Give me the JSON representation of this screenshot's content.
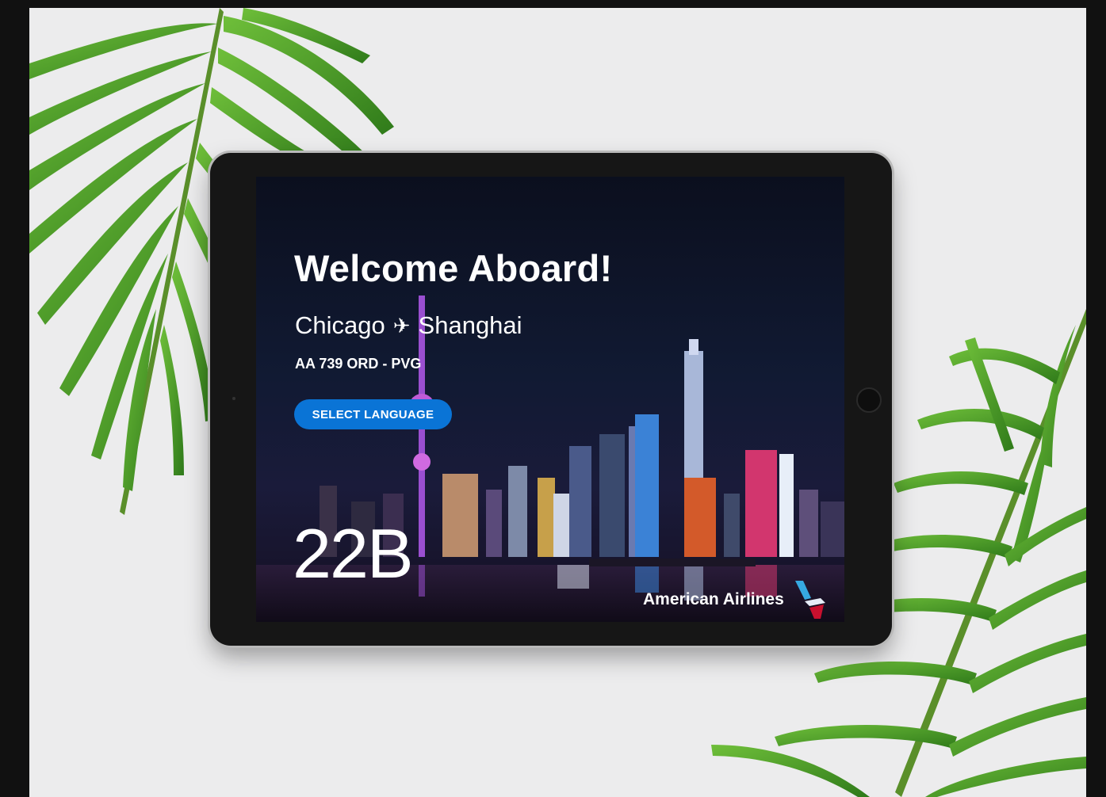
{
  "screen": {
    "welcome_title": "Welcome Aboard!",
    "origin": "Chicago",
    "destination": "Shanghai",
    "plane_icon": "✈",
    "flight_code": "AA 739 ORD - PVG",
    "select_language_label": "SELECT LANGUAGE",
    "seat": "22B",
    "brand_name": "American Airlines",
    "logo_icon": "american-airlines-flight-symbol-icon"
  },
  "colors": {
    "accent_button": "#0a74d6",
    "background": "#ececed",
    "frame": "#111111",
    "leaf": "#4f9b2a"
  }
}
